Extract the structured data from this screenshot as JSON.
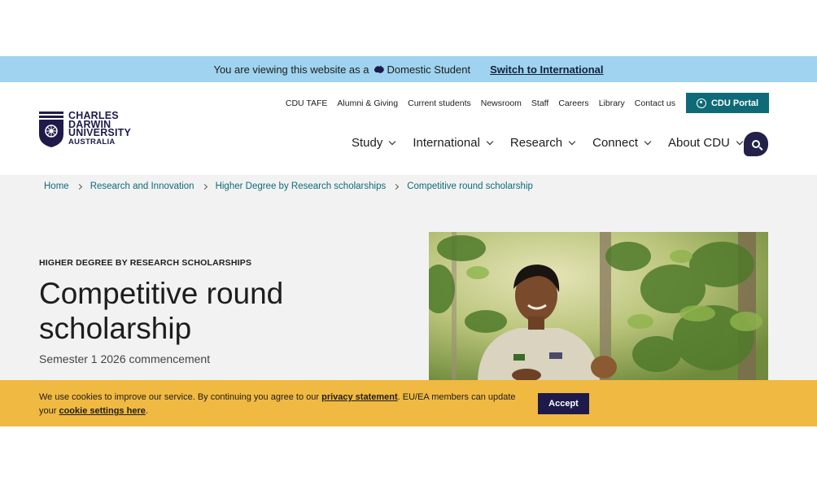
{
  "audience": {
    "prefix": "You are viewing this website as a",
    "current": "Domestic Student",
    "switch_label": "Switch to International"
  },
  "logo": {
    "line1": "CHARLES",
    "line2": "DARWIN",
    "line3": "UNIVERSITY",
    "line4": "AUSTRALIA"
  },
  "utility_nav": [
    "CDU TAFE",
    "Alumni & Giving",
    "Current students",
    "Newsroom",
    "Staff",
    "Careers",
    "Library",
    "Contact us"
  ],
  "portal_button": "CDU Portal",
  "main_nav": [
    "Study",
    "International",
    "Research",
    "Connect",
    "About CDU"
  ],
  "breadcrumb": [
    "Home",
    "Research and Innovation",
    "Higher Degree by Research scholarships",
    "Competitive round scholarship"
  ],
  "hero": {
    "eyebrow": "HIGHER DEGREE BY RESEARCH SCHOLARSHIPS",
    "title": "Competitive round scholarship",
    "subtitle": "Semester 1 2026 commencement"
  },
  "cookie": {
    "text_before": "We use cookies to improve our service. By continuing you agree to our ",
    "privacy_link": "privacy statement",
    "text_middle": ". EU/EA members can update your ",
    "settings_link": "cookie settings here",
    "text_after": ".",
    "accept_label": "Accept"
  },
  "colors": {
    "audience_bar": "#9fd3ef",
    "brand_navy": "#1e1b4b",
    "teal": "#0f6a78",
    "cookie_bar": "#f0b941",
    "hero_bg": "#f2f2f2"
  },
  "icons": [
    "australia-map-icon",
    "user-circle-icon",
    "chevron-down-icon",
    "search-icon",
    "chevron-right-icon"
  ]
}
